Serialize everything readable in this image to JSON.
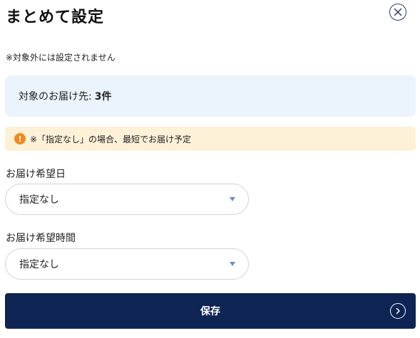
{
  "dialog": {
    "title": "まとめて設定",
    "close_icon": "close-icon"
  },
  "note": "※対象外には設定されません",
  "summary": {
    "label": "対象のお届け先:",
    "count": "3件"
  },
  "warning": {
    "icon": "!",
    "text": "※「指定なし」の場合、最短でお届け予定",
    "color": "#f08a1c",
    "background": "#fdf1d8"
  },
  "delivery_date": {
    "label": "お届け希望日",
    "value": "指定なし"
  },
  "delivery_time": {
    "label": "お届け希望時間",
    "value": "指定なし"
  },
  "save_button": {
    "label": "保存",
    "icon": "chevron-right-circle-icon",
    "color": "#0e2452"
  }
}
